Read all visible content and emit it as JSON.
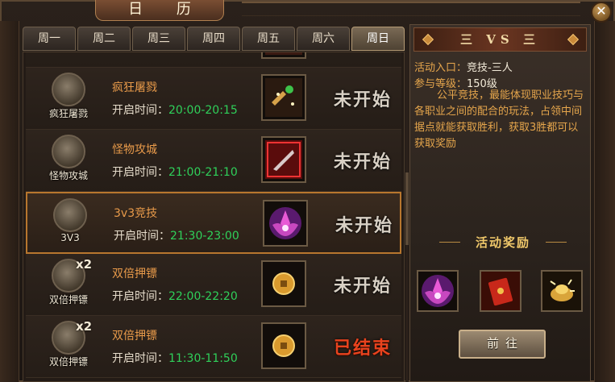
{
  "window": {
    "title": "日 历",
    "close_icon": "close-icon",
    "close_glyph": "✕"
  },
  "tabs": [
    {
      "label": "周一",
      "active": false
    },
    {
      "label": "周二",
      "active": false
    },
    {
      "label": "周三",
      "active": false
    },
    {
      "label": "周四",
      "active": false
    },
    {
      "label": "周五",
      "active": false
    },
    {
      "label": "周六",
      "active": false
    },
    {
      "label": "周日",
      "active": true
    }
  ],
  "list": {
    "time_prefix": "开启时间：",
    "rows": [
      {
        "emblem_label": "",
        "emblem_x2": "",
        "name": "",
        "time": "",
        "status": "",
        "ended": false,
        "selected": false,
        "item_icon": "partial-row-item"
      },
      {
        "emblem_label": "疯狂屠戮",
        "emblem_x2": "",
        "name": "疯狂屠戮",
        "time": "20:00-20:15",
        "status": "未开始",
        "ended": false,
        "selected": false,
        "item_icon": "gold-sparkle-box-icon"
      },
      {
        "emblem_label": "怪物攻城",
        "emblem_x2": "",
        "name": "怪物攻城",
        "time": "21:00-21:10",
        "status": "未开始",
        "ended": false,
        "selected": false,
        "item_icon": "red-blade-box-icon"
      },
      {
        "emblem_label": "3V3",
        "emblem_x2": "",
        "name": "3v3竞技",
        "time": "21:30-23:00",
        "status": "未开始",
        "ended": false,
        "selected": true,
        "item_icon": "purple-lotus-icon"
      },
      {
        "emblem_label": "双倍押镖",
        "emblem_x2": "x2",
        "name": "双倍押镖",
        "time": "22:00-22:20",
        "status": "未开始",
        "ended": false,
        "selected": false,
        "item_icon": "gold-coin-icon"
      },
      {
        "emblem_label": "双倍押镖",
        "emblem_x2": "x2",
        "name": "双倍押镖",
        "time": "11:30-11:50",
        "status": "已结束",
        "ended": true,
        "selected": false,
        "item_icon": "gold-coin-icon"
      }
    ]
  },
  "detail": {
    "title": "三 VS 三",
    "entry_label": "活动入口：",
    "entry_value": "竞技-三人",
    "level_label": "参与等级：",
    "level_value": "150级",
    "description": "公平竞技，最能体现职业技巧与各职业之间的配合的玩法，占领中间据点就能获取胜利，获取3胜都可以获取奖励",
    "reward_title": "活动奖励",
    "rewards": [
      "purple-lotus-icon",
      "red-envelope-icon",
      "gold-ingot-icon"
    ],
    "go_button": "前往"
  },
  "colors": {
    "accent_orange": "#e89a4a",
    "time_green": "#2fd05a",
    "ended_red": "#e8431e",
    "info_gold": "#e6a64c"
  }
}
